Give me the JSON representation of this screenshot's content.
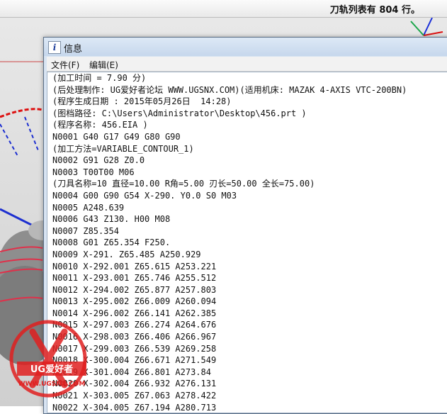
{
  "statusbar": {
    "message": "刀轨列表有 804 行。"
  },
  "window": {
    "title": "信息",
    "menu": [
      {
        "label": "文件(F)"
      },
      {
        "label": "编辑(E)"
      }
    ],
    "lines": [
      "(加工时间 = 7.90 分)",
      "(后处理制作: UG爱好者论坛 WWW.UGSNX.COM)(适用机床: MAZAK 4-AXIS VTC-200BN)",
      "(程序生成日期 : 2015年05月26日  14:28)",
      "(图档路径: C:\\Users\\Administrator\\Desktop\\456.prt )",
      "(程序名称: 456.EIA )",
      "N0001 G40 G17 G49 G80 G90",
      "(加工方法=VARIABLE_CONTOUR_1)",
      "N0002 G91 G28 Z0.0",
      "N0003 T00T00 M06",
      "(刀具名称=10 直径=10.00 R角=5.00 刃长=50.00 全长=75.00)",
      "N0004 G00 G90 G54 X-290. Y0.0 S0 M03",
      "N0005 A248.639",
      "N0006 G43 Z130. H00 M08",
      "N0007 Z85.354",
      "N0008 G01 Z65.354 F250.",
      "N0009 X-291. Z65.485 A250.929",
      "N0010 X-292.001 Z65.615 A253.221",
      "N0011 X-293.001 Z65.746 A255.512",
      "N0012 X-294.002 Z65.877 A257.803",
      "N0013 X-295.002 Z66.009 A260.094",
      "N0014 X-296.002 Z66.141 A262.385",
      "N0015 X-297.003 Z66.274 A264.676",
      "N0016 X-298.003 Z66.406 A266.967",
      "N0017 X-299.003 Z66.539 A269.258",
      "N0018 X-300.004 Z66.671 A271.549",
      "N0019 X-301.004 Z66.801 A273.84",
      "N0020 X-302.004 Z66.932 A276.131",
      "N0021 X-303.005 Z67.063 A278.422",
      "N0022 X-304.005 Z67.194 A280.713"
    ]
  },
  "watermark": {
    "brand": "UG爱好者",
    "url": "WWW.UGSNX.COM"
  }
}
